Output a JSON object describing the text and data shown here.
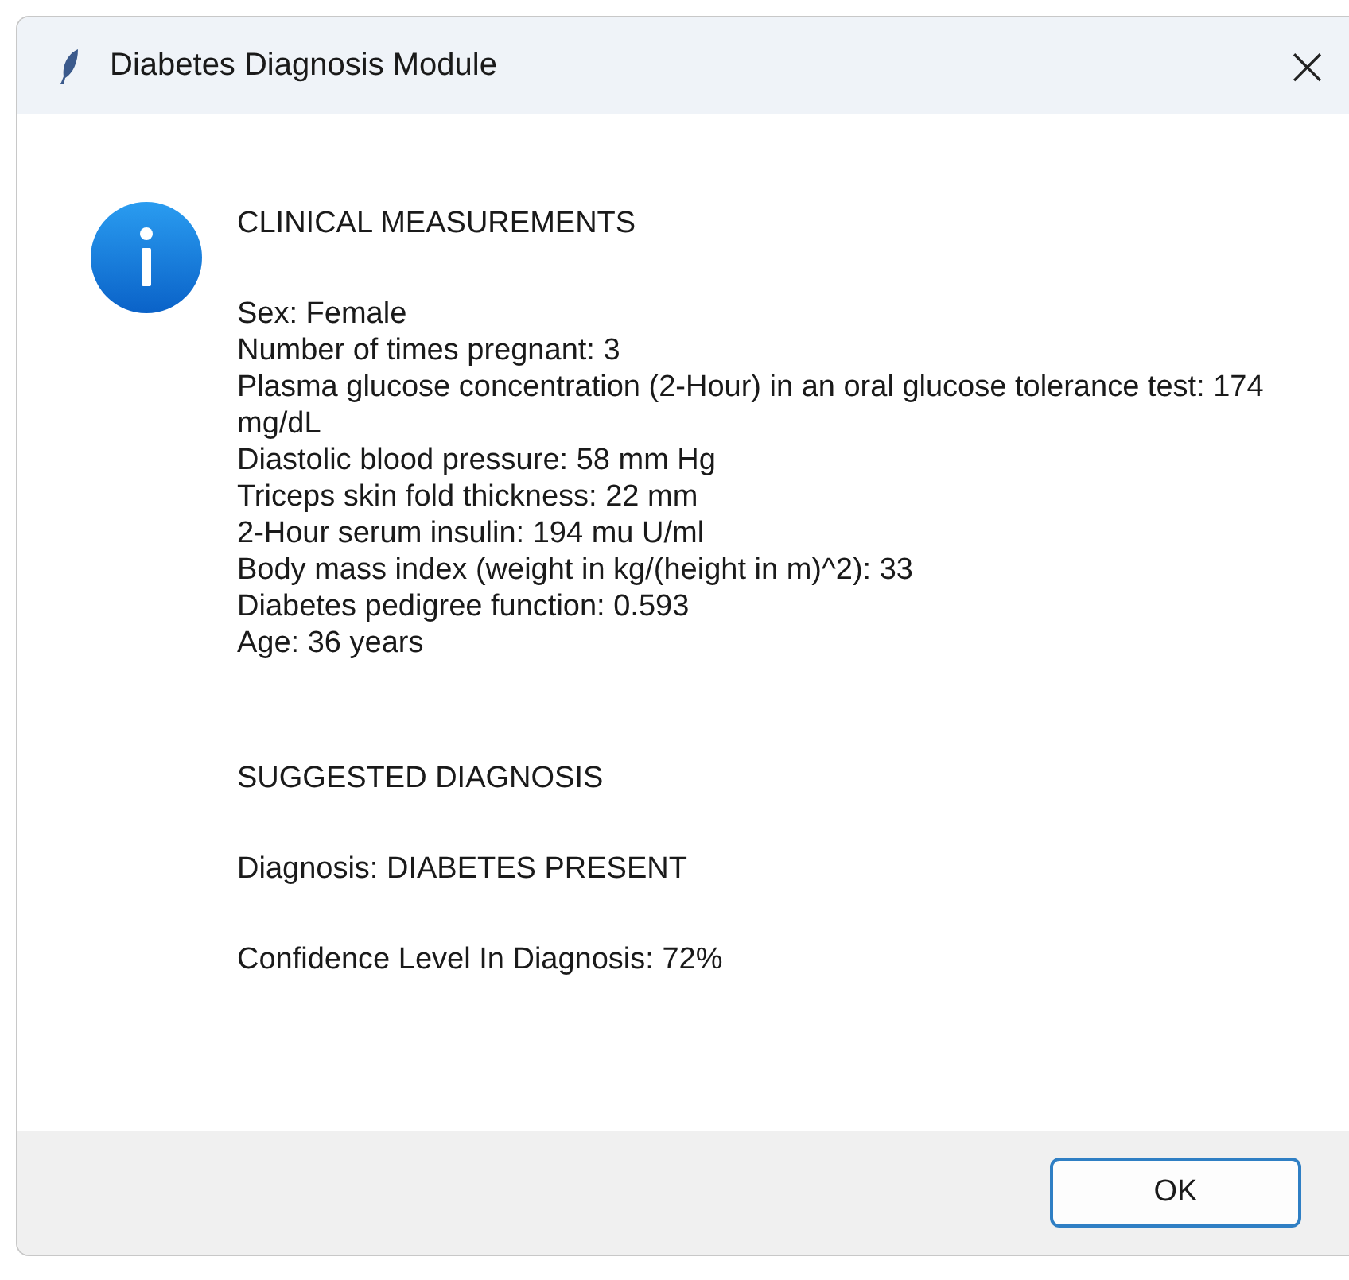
{
  "window": {
    "title": "Diabetes Diagnosis Module",
    "close": "×"
  },
  "sections": [
    {
      "heading": "CLINICAL MEASUREMENTS",
      "paragraphs": [
        [
          "Sex:  Female",
          "Number of times pregnant: 3",
          "Plasma glucose concentration (2-Hour) in an oral glucose tolerance test: 174 mg/dL",
          "Diastolic blood pressure: 58 mm Hg",
          "Triceps skin fold thickness: 22 mm",
          "2-Hour serum insulin: 194 mu U/ml",
          "Body mass index (weight in kg/(height in m)^2): 33",
          "Diabetes pedigree function: 0.593",
          "Age: 36 years"
        ]
      ]
    },
    {
      "heading": "SUGGESTED DIAGNOSIS",
      "paragraphs": [
        [
          "Diagnosis: DIABETES PRESENT"
        ],
        [
          "Confidence Level In Diagnosis: 72%"
        ]
      ]
    }
  ],
  "buttons": [
    "OK"
  ]
}
